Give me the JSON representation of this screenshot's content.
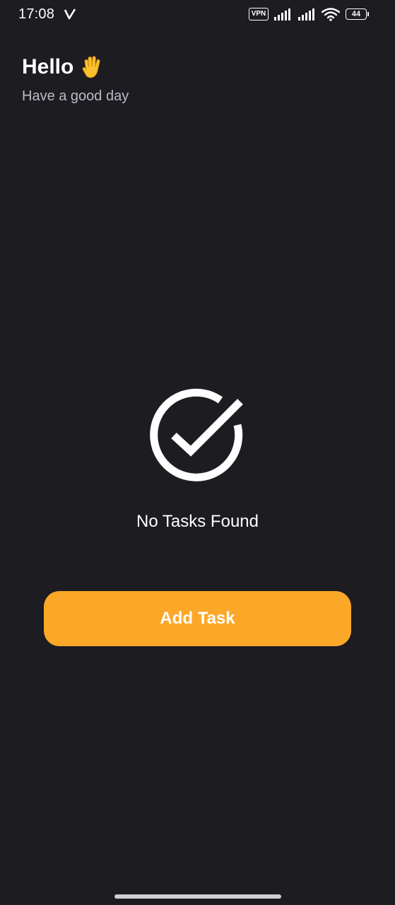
{
  "status_bar": {
    "time": "17:08",
    "vpn_label": "VPN",
    "battery_level": "44",
    "icons": [
      "v-icon",
      "signal-icon",
      "signal-icon",
      "wifi-icon",
      "battery-icon"
    ]
  },
  "header": {
    "title": "Hello",
    "subtitle": "Have a good day",
    "title_icon": "waving-hand-icon"
  },
  "empty_state": {
    "icon": "check-circle-icon",
    "message": "No Tasks Found"
  },
  "actions": {
    "add_task_label": "Add Task"
  },
  "colors": {
    "background": "#1c1c21",
    "accent": "#fba828",
    "subtitle": "#b9bcc4",
    "text": "#ffffff"
  }
}
